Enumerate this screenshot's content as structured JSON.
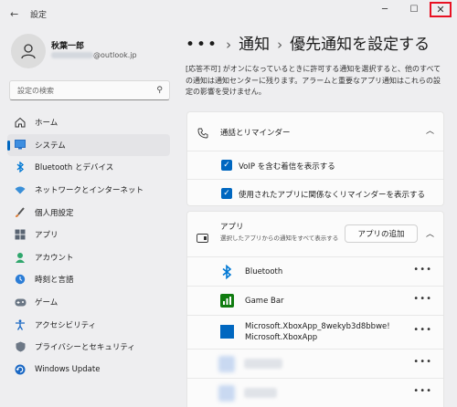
{
  "window": {
    "title": "設定",
    "minimize": "─",
    "maximize": "☐",
    "close": "✕"
  },
  "profile": {
    "name": "秋葉一郎",
    "email_suffix": "@outlook.jp"
  },
  "search": {
    "placeholder": "設定の検索"
  },
  "sidebar": {
    "items": [
      {
        "label": "ホーム",
        "icon": "home-icon",
        "active": false
      },
      {
        "label": "システム",
        "icon": "system-icon",
        "active": true
      },
      {
        "label": "Bluetooth とデバイス",
        "icon": "bluetooth-icon",
        "active": false
      },
      {
        "label": "ネットワークとインターネット",
        "icon": "network-icon",
        "active": false
      },
      {
        "label": "個人用設定",
        "icon": "personalization-icon",
        "active": false
      },
      {
        "label": "アプリ",
        "icon": "apps-icon",
        "active": false
      },
      {
        "label": "アカウント",
        "icon": "account-icon",
        "active": false
      },
      {
        "label": "時刻と言語",
        "icon": "time-language-icon",
        "active": false
      },
      {
        "label": "ゲーム",
        "icon": "gaming-icon",
        "active": false
      },
      {
        "label": "アクセシビリティ",
        "icon": "accessibility-icon",
        "active": false
      },
      {
        "label": "プライバシーとセキュリティ",
        "icon": "privacy-icon",
        "active": false
      },
      {
        "label": "Windows Update",
        "icon": "windows-update-icon",
        "active": false
      }
    ]
  },
  "breadcrumb": {
    "more": "•••",
    "parent": "通知",
    "current": "優先通知を設定する"
  },
  "description": "[応答不可] がオンになっているときに許可する通知を選択すると、他のすべての通知は通知センターに残ります。アラームと重要なアプリ通知はこれらの設定の影響を受けません。",
  "calls_section": {
    "title": "通話とリマインダー",
    "options": [
      {
        "label": "VoIP を含む着信を表示する",
        "checked": true
      },
      {
        "label": "使用されたアプリに関係なくリマインダーを表示する",
        "checked": true
      }
    ]
  },
  "apps_section": {
    "title": "アプリ",
    "subtitle": "選択したアプリからの通知をすべて表示する",
    "add_button": "アプリの追加",
    "apps": [
      {
        "name": "Bluetooth",
        "icon": "bluetooth-app-icon"
      },
      {
        "name": "Game Bar",
        "icon": "game-bar-icon"
      },
      {
        "name": "Microsoft.XboxApp_8wekyb3d8bbwe!\nMicrosoft.XboxApp",
        "icon": "xbox-app-icon"
      }
    ],
    "more_label": "•••"
  },
  "colors": {
    "accent": "#0067c0",
    "close_highlight": "#e81123"
  }
}
